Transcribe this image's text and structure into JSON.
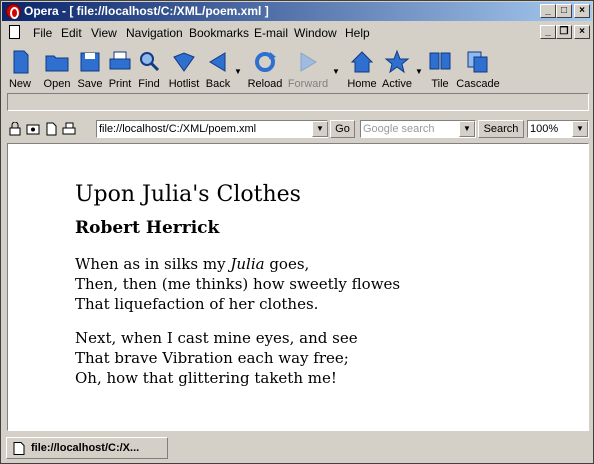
{
  "window": {
    "title": "Opera - [ file://localhost/C:/XML/poem.xml ]"
  },
  "menubar": {
    "items": [
      "File",
      "Edit",
      "View",
      "Navigation",
      "Bookmarks",
      "E-mail",
      "Window",
      "Help"
    ]
  },
  "toolbar": {
    "new": "New",
    "open": "Open",
    "save": "Save",
    "print": "Print",
    "find": "Find",
    "hotlist": "Hotlist",
    "back": "Back",
    "reload": "Reload",
    "forward": "Forward",
    "home": "Home",
    "active": "Active",
    "tile": "Tile",
    "cascade": "Cascade"
  },
  "address": {
    "url": "file://localhost/C:/XML/poem.xml",
    "go": "Go",
    "search_placeholder": "Google search",
    "search_button": "Search",
    "zoom": "100%"
  },
  "poem": {
    "title": "Upon Julia's Clothes",
    "author": "Robert Herrick",
    "stanza1": {
      "line1_before": "When as in silks my ",
      "line1_name": "Julia",
      "line1_after": " goes,",
      "line2": "Then, then (me thinks) how sweetly flowes",
      "line3": "That liquefaction of her clothes."
    },
    "stanza2": {
      "line1": "Next, when I cast mine eyes, and see",
      "line2": "That brave Vibration each way free;",
      "line3": "Oh, how that glittering taketh me!"
    }
  },
  "statusbar": {
    "tab_label": "file://localhost/C:/X..."
  },
  "colors": {
    "titlebar_start": "#0a246a",
    "titlebar_end": "#a6caf0",
    "toolbar_icon": "#2f6fcf"
  }
}
